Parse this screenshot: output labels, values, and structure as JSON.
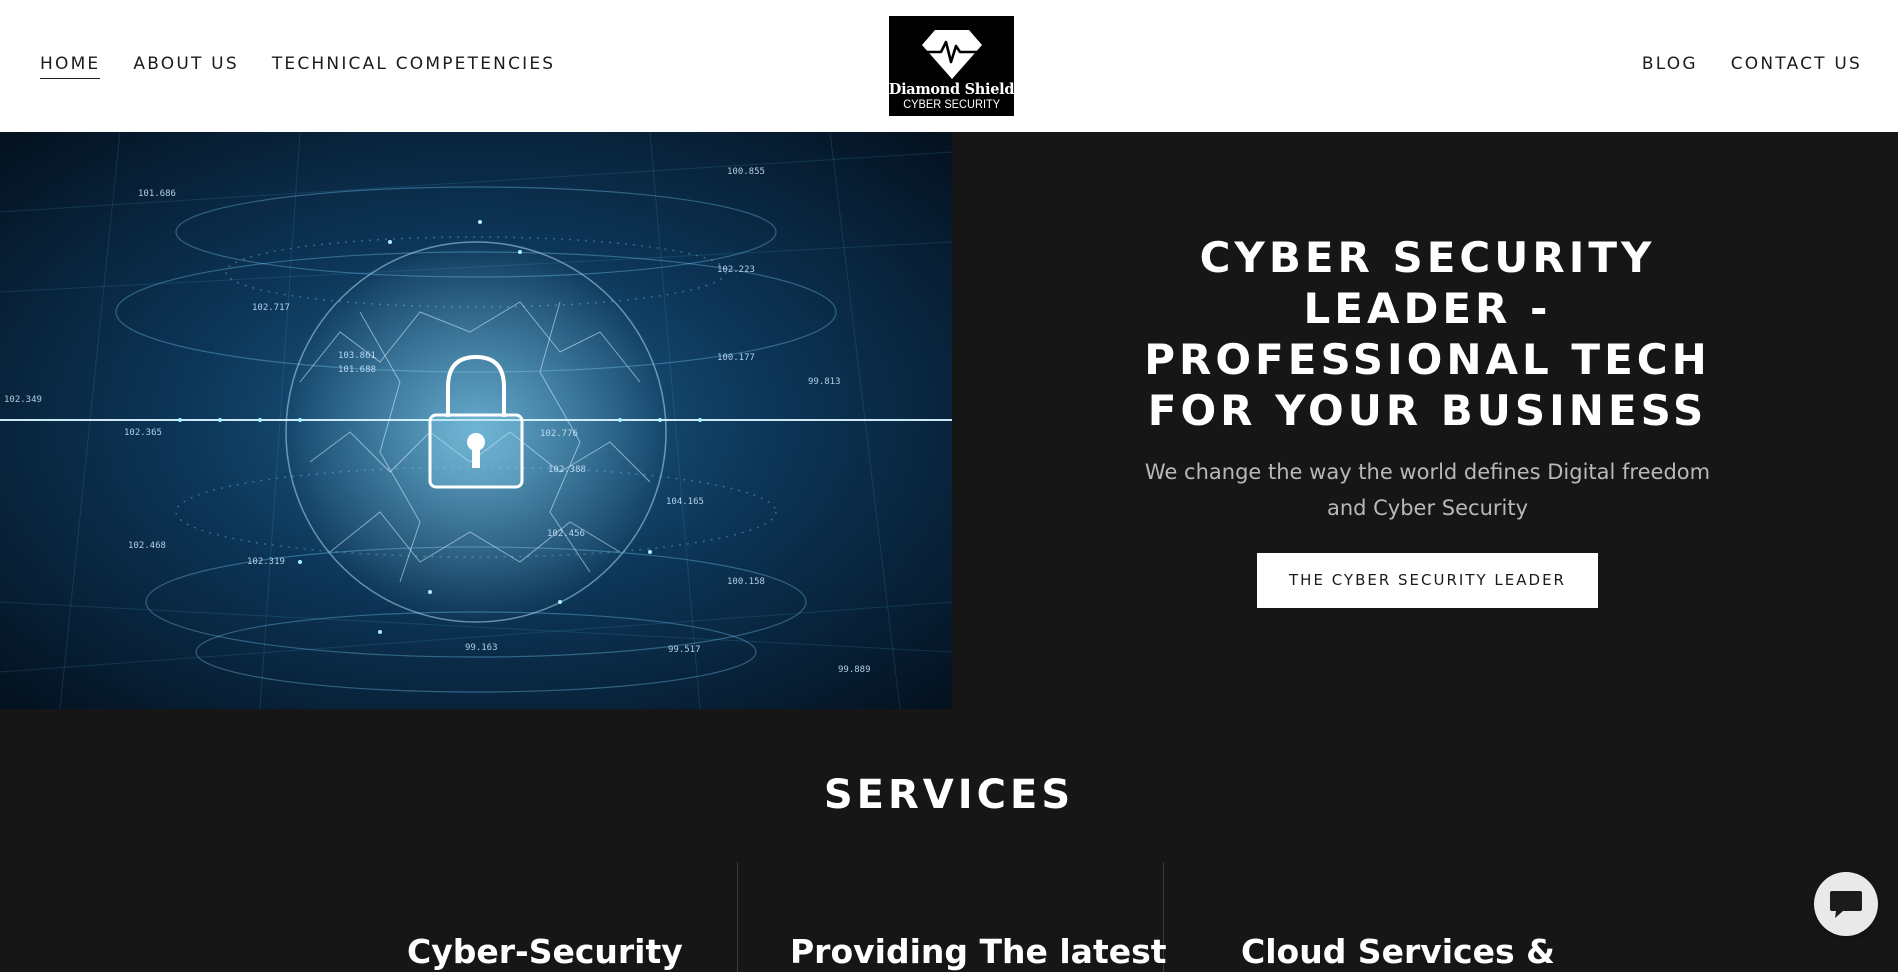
{
  "header": {
    "nav_left": [
      "HOME",
      "ABOUT US",
      "TECHNICAL COMPETENCIES"
    ],
    "nav_right": [
      "BLOG",
      "CONTACT US"
    ],
    "active_item": "HOME",
    "logo": {
      "name": "Diamond Shield",
      "subtitle": "CYBER SECURITY",
      "icon": "diamond-heartbeat-icon"
    }
  },
  "hero": {
    "image_description_icon": "padlock-globe-icon",
    "image_numbers": [
      "101.686",
      "100.855",
      "102.223",
      "102.717",
      "102.349",
      "102.365",
      "99.813",
      "102.776",
      "102.388",
      "104.165",
      "102.456",
      "102.468",
      "102.319",
      "100.158",
      "99.163",
      "99.889",
      "100.177",
      "103.861",
      "101.688",
      "99.517"
    ],
    "title": "CYBER SECURITY LEADER - PROFESSIONAL TECH FOR YOUR BUSINESS",
    "subtitle": "We change the way the world defines Digital freedom and Cyber Security",
    "cta_label": "THE CYBER SECURITY LEADER"
  },
  "services": {
    "title": "SERVICES",
    "items": [
      "Cyber-Security",
      "Providing The latest",
      "Cloud Services &"
    ]
  },
  "chat": {
    "icon": "chat-bubble-icon"
  },
  "colors": {
    "header_bg": "#ffffff",
    "page_bg": "#161616",
    "accent_blue": "#0d3a5c",
    "text_light": "#ffffff",
    "text_muted": "#b8b8b8"
  }
}
